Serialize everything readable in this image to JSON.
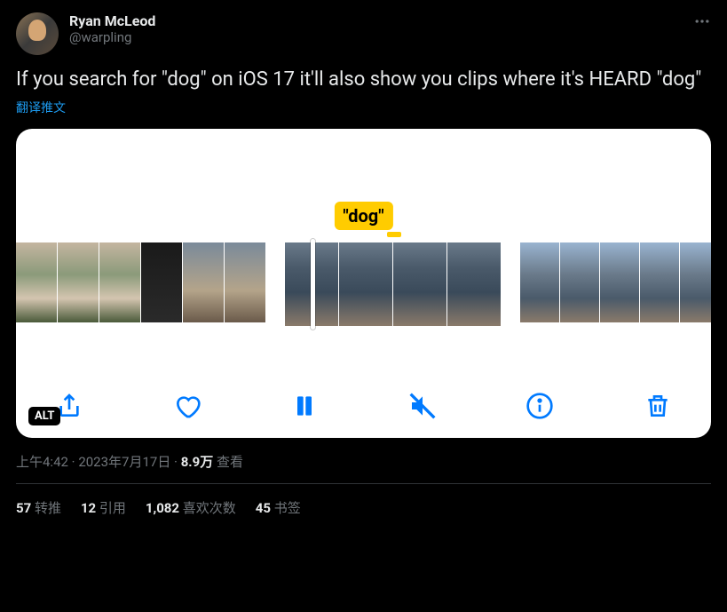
{
  "author": {
    "display_name": "Ryan McLeod",
    "handle": "@warpling"
  },
  "tweet_text": "If you search for \"dog\" on iOS 17 it'll also show you clips where it's HEARD \"dog\"",
  "translate_label": "翻译推文",
  "media": {
    "tag_text": "\"dog\"",
    "alt_label": "ALT",
    "toolbar": {
      "share": "share-icon",
      "like": "heart-icon",
      "pause": "pause-icon",
      "mute": "mute-icon",
      "info": "info-icon",
      "delete": "trash-icon"
    }
  },
  "meta": {
    "time": "上午4:42",
    "sep": " · ",
    "date": "2023年7月17日",
    "views_num": "8.9万",
    "views_label": " 查看"
  },
  "stats": {
    "retweets_num": "57",
    "retweets_label": " 转推",
    "quotes_num": "12",
    "quotes_label": " 引用",
    "likes_num": "1,082",
    "likes_label": " 喜欢次数",
    "bookmarks_num": "45",
    "bookmarks_label": " 书签"
  }
}
